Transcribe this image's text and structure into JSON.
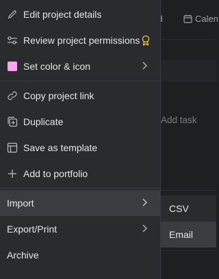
{
  "background": {
    "tabs": {
      "board": "rd",
      "calendar": "Calen"
    },
    "add_task": "Add task"
  },
  "menu": {
    "edit_details": "Edit project details",
    "review_permissions": "Review project permissions",
    "set_color": "Set color & icon",
    "swatch_color": "#f8a4f2",
    "copy_link": "Copy project link",
    "duplicate": "Duplicate",
    "save_template": "Save as template",
    "add_portfolio": "Add to portfolio",
    "import": "Import",
    "export_print": "Export/Print",
    "archive": "Archive"
  },
  "submenu": {
    "csv": "CSV",
    "email": "Email"
  },
  "colors": {
    "menu_bg": "#2a2b2d",
    "hover_bg": "#3b3c3f",
    "award_color": "#f2c14e"
  }
}
